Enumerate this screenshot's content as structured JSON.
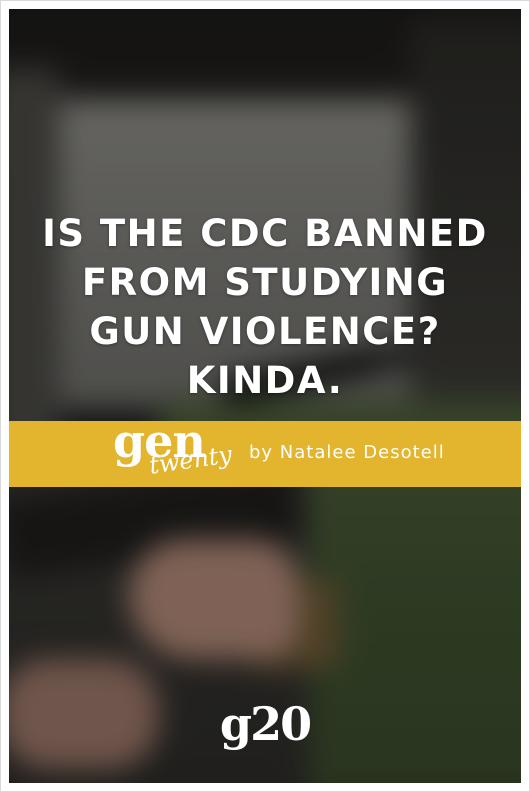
{
  "headline": {
    "lines": [
      "IS THE CDC BANNED",
      "FROM STUDYING",
      "GUN VIOLENCE?",
      "KINDA."
    ]
  },
  "brand": {
    "logo_gen": "gen",
    "logo_twenty": "twenty",
    "byline": "by Natalee Desotell",
    "footer_logo": "g20",
    "accent_color": "#e3b42e"
  }
}
